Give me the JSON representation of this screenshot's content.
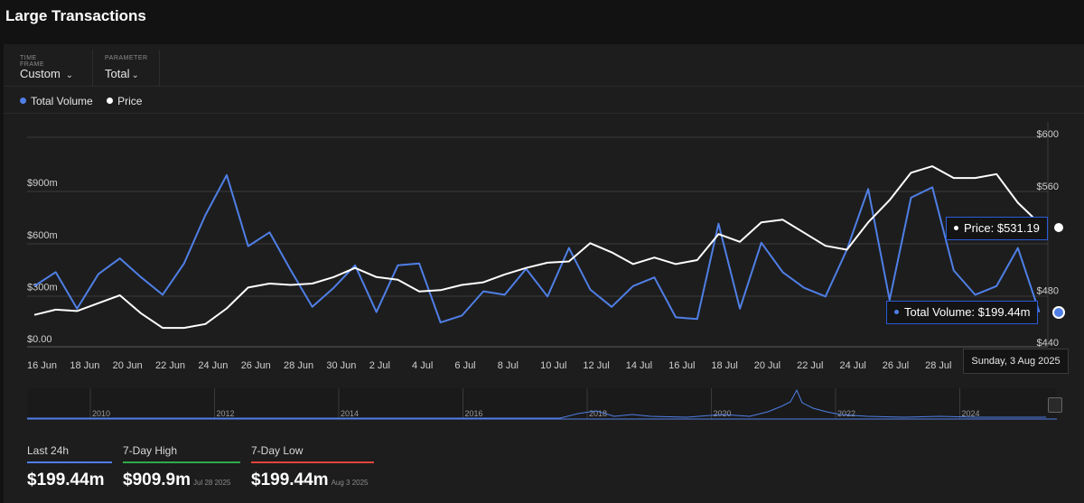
{
  "page": {
    "title": "Large Transactions"
  },
  "controls": {
    "timeframe": {
      "caption": "TIME FRAME",
      "value": "Custom"
    },
    "parameter": {
      "caption": "PARAMETER",
      "value": "Total"
    }
  },
  "legend": [
    {
      "label": "Total Volume",
      "color": "#4f7fe6"
    },
    {
      "label": "Price",
      "color": "#ffffff"
    }
  ],
  "tooltips": {
    "price": "Price: $531.19",
    "volume": "Total Volume: $199.44m",
    "date": "Sunday, 3 Aug 2025"
  },
  "stats": [
    {
      "label": "Last 24h",
      "value": "$199.44m",
      "date": "",
      "color": "#4f7fe6"
    },
    {
      "label": "7-Day High",
      "value": "$909.9m",
      "date": "Jul 28 2025",
      "color": "#2eaa4a"
    },
    {
      "label": "7-Day Low",
      "value": "$199.44m",
      "date": "Aug 3 2025",
      "color": "#e0443a"
    }
  ],
  "navigator": {
    "year_labels": [
      "2010",
      "2012",
      "2014",
      "2016",
      "2018",
      "2020",
      "2022",
      "2024"
    ]
  },
  "chart_data": {
    "type": "line",
    "x": [
      "2025-06-16",
      "2025-06-17",
      "2025-06-18",
      "2025-06-19",
      "2025-06-20",
      "2025-06-21",
      "2025-06-22",
      "2025-06-23",
      "2025-06-24",
      "2025-06-25",
      "2025-06-26",
      "2025-06-27",
      "2025-06-28",
      "2025-06-29",
      "2025-06-30",
      "2025-07-01",
      "2025-07-02",
      "2025-07-03",
      "2025-07-04",
      "2025-07-05",
      "2025-07-06",
      "2025-07-07",
      "2025-07-08",
      "2025-07-09",
      "2025-07-10",
      "2025-07-11",
      "2025-07-12",
      "2025-07-13",
      "2025-07-14",
      "2025-07-15",
      "2025-07-16",
      "2025-07-17",
      "2025-07-18",
      "2025-07-19",
      "2025-07-20",
      "2025-07-21",
      "2025-07-22",
      "2025-07-23",
      "2025-07-24",
      "2025-07-25",
      "2025-07-26",
      "2025-07-27",
      "2025-07-28",
      "2025-07-29",
      "2025-07-30",
      "2025-07-31",
      "2025-08-01",
      "2025-08-02",
      "2025-08-03"
    ],
    "x_tick_labels": [
      "16 Jun",
      "18 Jun",
      "20 Jun",
      "22 Jun",
      "24 Jun",
      "26 Jun",
      "28 Jun",
      "30 Jun",
      "2 Jul",
      "4 Jul",
      "6 Jul",
      "8 Jul",
      "10 Jul",
      "12 Jul",
      "14 Jul",
      "16 Jul",
      "18 Jul",
      "20 Jul",
      "22 Jul",
      "24 Jul",
      "26 Jul",
      "28 Jul",
      "3"
    ],
    "y_left": {
      "ticks": [
        "$0.00",
        "$300m",
        "$600m",
        "$900m"
      ],
      "tick_values": [
        0,
        300,
        600,
        900
      ],
      "range": [
        0,
        1200
      ]
    },
    "y_right": {
      "ticks": [
        "$440",
        "$480",
        "",
        "$560",
        "$600"
      ],
      "tick_values": [
        440,
        480,
        520,
        560,
        600
      ],
      "range": [
        440,
        600
      ]
    },
    "series": [
      {
        "name": "Total Volume",
        "axis": "left",
        "color": "#4f7fe6",
        "values": [
          350,
          430,
          220,
          420,
          510,
          400,
          300,
          480,
          760,
          990,
          580,
          660,
          440,
          230,
          340,
          470,
          200,
          470,
          480,
          140,
          180,
          320,
          300,
          450,
          290,
          570,
          330,
          230,
          350,
          400,
          170,
          160,
          710,
          220,
          600,
          430,
          340,
          290,
          560,
          910,
          270,
          860,
          920,
          440,
          300,
          350,
          570,
          199.44,
          null
        ]
      },
      {
        "name": "Price",
        "axis": "right",
        "color": "#ffffff",
        "values": [
          461,
          465,
          464,
          470,
          476,
          462,
          451,
          451,
          454,
          466,
          482,
          485,
          484,
          485,
          490,
          497,
          490,
          488,
          479,
          480,
          484,
          486,
          492,
          497,
          501,
          502,
          516,
          509,
          500,
          505,
          500,
          503,
          523,
          517,
          532,
          534,
          524,
          514,
          511,
          532,
          549,
          570,
          575,
          566,
          566,
          569,
          547,
          531.19,
          null
        ]
      }
    ]
  }
}
